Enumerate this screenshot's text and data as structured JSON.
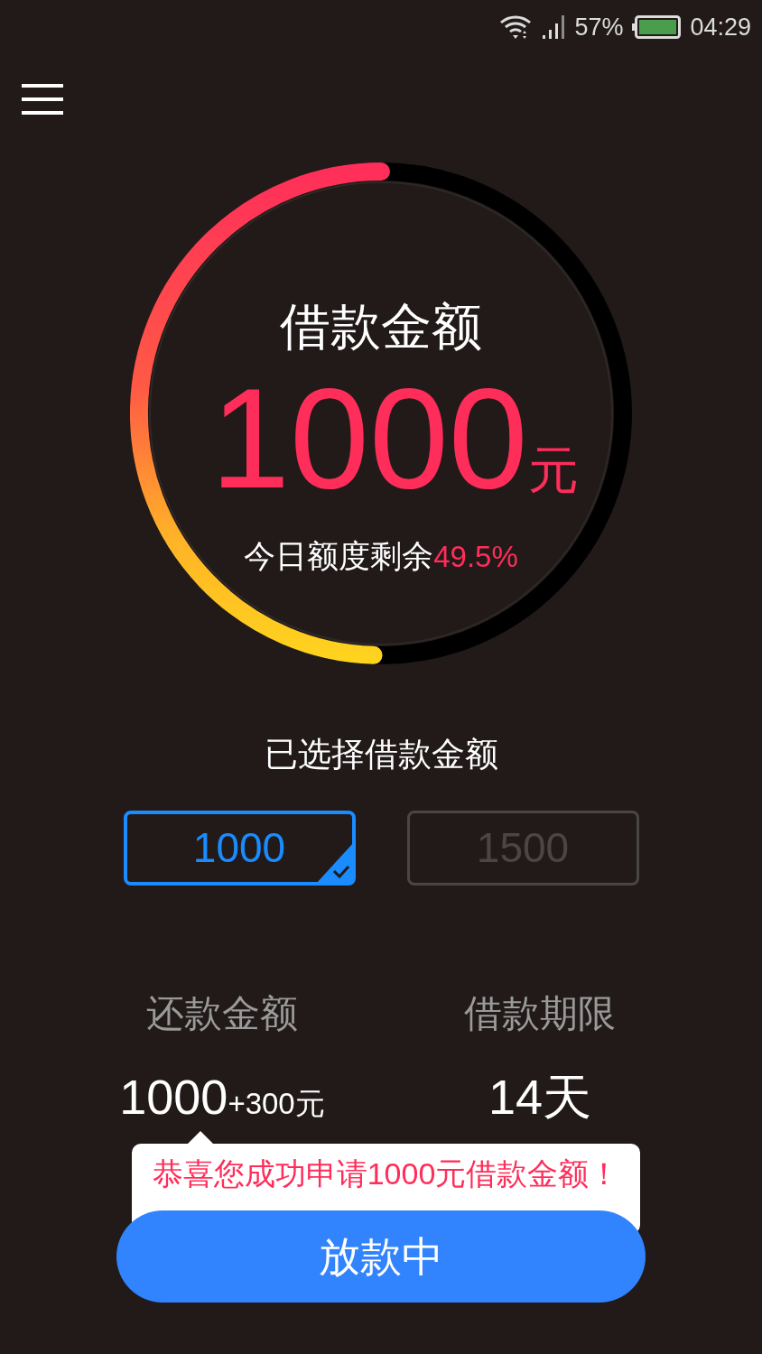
{
  "status_bar": {
    "battery": "57%",
    "time": "04:29"
  },
  "gauge": {
    "title": "借款金额",
    "amount": "1000",
    "unit": "元",
    "remaining_label": "今日额度剩余",
    "remaining_value": "49.5%",
    "level": 0.495
  },
  "amount_section": {
    "title": "已选择借款金额",
    "options": [
      {
        "label": "1000",
        "selected": true
      },
      {
        "label": "1500",
        "selected": false
      }
    ]
  },
  "summary": [
    {
      "label": "还款金额",
      "value": "1000",
      "extra": "+300元"
    },
    {
      "label": "借款期限",
      "value": "14天"
    }
  ],
  "tooltip": {
    "text": "恭喜您成功申请1000元借款金额！"
  },
  "button": {
    "label": "放款中"
  }
}
